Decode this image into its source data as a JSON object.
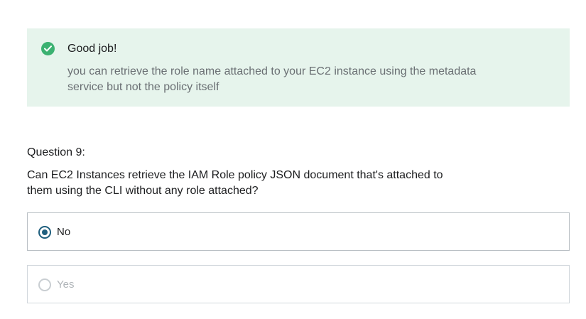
{
  "feedback": {
    "icon": "check-circle-icon",
    "status_color": "#3bb171",
    "title": "Good job!",
    "explanation": "you can retrieve the role name attached to your EC2 instance using the metadata service but not the policy itself"
  },
  "question": {
    "number_label": "Question 9:",
    "text": "Can EC2 Instances retrieve the IAM Role policy JSON document that's attached to them using the CLI without any role attached?"
  },
  "options": [
    {
      "label": "No",
      "selected": true
    },
    {
      "label": "Yes",
      "selected": false
    }
  ]
}
